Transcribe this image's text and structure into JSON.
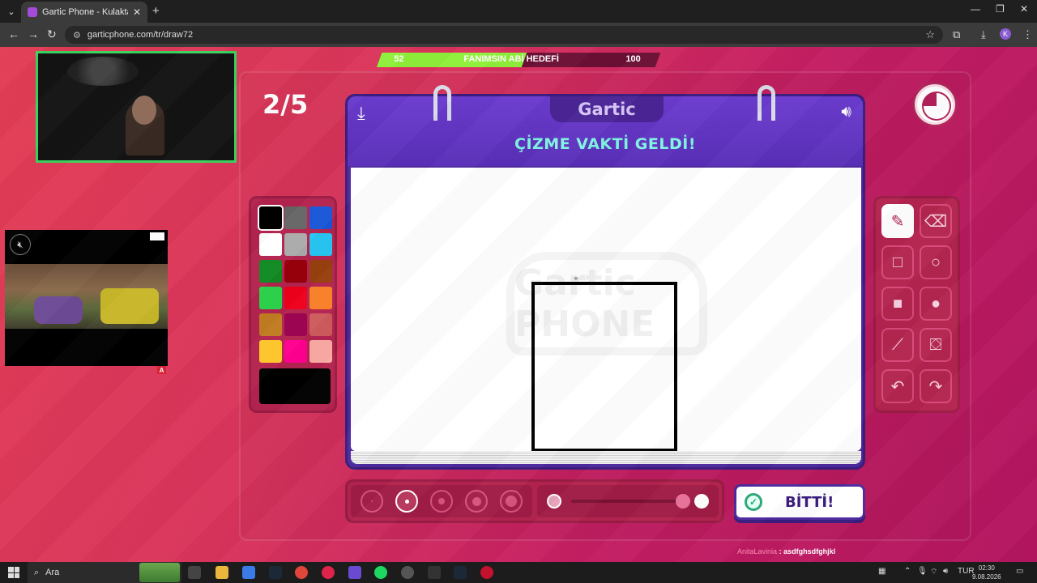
{
  "browser": {
    "tab_title": "Gartic Phone - Kulaktan Kulağa",
    "url": "garticphone.com/tr/draw72",
    "profile_initial": "K"
  },
  "stream": {
    "goal_current": "52",
    "goal_label": "FANIMSIN ABİ HEDEFİ",
    "goal_target": "100",
    "goal_progress": 0.52
  },
  "game": {
    "round": "2/5",
    "board_title": "Gartic",
    "prompt": "ÇİZME VAKTİ GELDİ!",
    "watermark": "Gartic PHONE",
    "timer_elapsed_fraction": 0.75,
    "done_label": "BİTTİ!",
    "selected_color": "#000000",
    "palette": [
      "#000000",
      "#666666",
      "#1a56d6",
      "#ffffff",
      "#aaaaaa",
      "#29c6f4",
      "#108a22",
      "#98000a",
      "#98400e",
      "#2dd44b",
      "#f0001c",
      "#f77f27",
      "#c17c22",
      "#99004e",
      "#cd5b5c",
      "#fdc52a",
      "#ff008f",
      "#fbaaa4"
    ],
    "tools": [
      "pencil-icon",
      "eraser-icon",
      "rectangle-outline-icon",
      "ellipse-outline-icon",
      "rectangle-fill-icon",
      "ellipse-fill-icon",
      "line-icon",
      "bucket-icon",
      "undo-icon",
      "redo-icon"
    ],
    "selected_tool": "pencil-icon",
    "brush_sizes": 5,
    "selected_size_index": 1,
    "opacity_level": 1.0
  },
  "chat": {
    "user": "AnitaLavinia",
    "separator": ":",
    "message": "asdfghsdfghjkl"
  },
  "taskbar": {
    "search_label": "Ara",
    "lang": "TUR",
    "time": "02:30",
    "date": "9.08.2026"
  }
}
